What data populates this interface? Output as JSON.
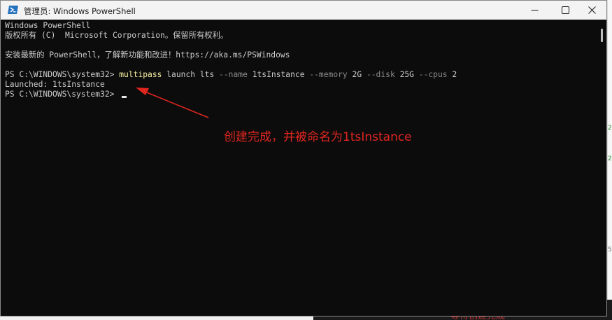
{
  "window": {
    "title": "管理员: Windows PowerShell",
    "icon": "powershell-icon",
    "controls": [
      "minimize-icon",
      "maximize-icon",
      "close-icon"
    ]
  },
  "console": {
    "lines": [
      "Windows PowerShell",
      "版权所有 (C)  Microsoft Corporation。保留所有权利。",
      "",
      "安装最新的 PowerShell，了解新功能和改进！https://aka.ms/PSWindows",
      "",
      "Launched: 1tsInstance"
    ],
    "prompt": "PS C:\\WINDOWS\\system32> ",
    "command": {
      "exe": "multipass",
      "args1": " launch lts ",
      "flag_name": "--name",
      "name_value": " 1tsInstance ",
      "flag_memory": "--memory",
      "memory_value": " 2G ",
      "flag_disk": "--disk",
      "disk_value": " 25G ",
      "flag_cpus": "--cpus",
      "cpus_value": " 2"
    },
    "colors": {
      "background": "#0c0c0c",
      "text": "#cccccc",
      "command": "#f9f1a5",
      "parameter": "#8a8a8a"
    }
  },
  "annotation": {
    "text": "创建完成，并被命名为1tsInstance",
    "color": "#e0261f"
  },
  "background_window": {
    "bottom_text": "等待创建完成",
    "side_glyphs": [
      "2",
      "2",
      "5"
    ]
  }
}
